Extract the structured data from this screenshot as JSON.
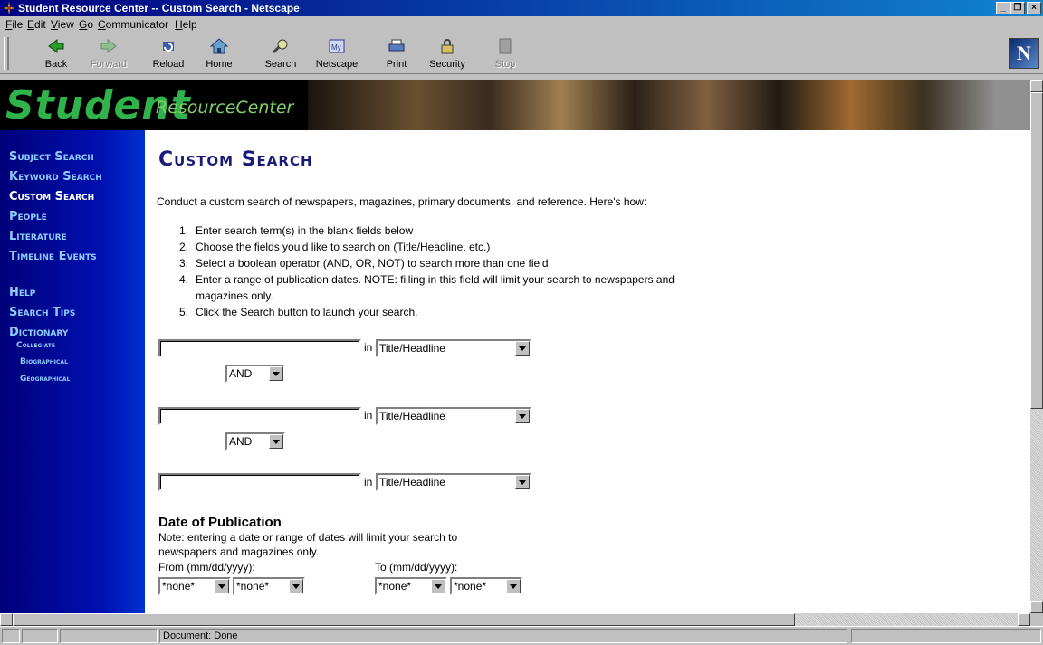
{
  "window": {
    "title": "Student Resource Center -- Custom Search - Netscape"
  },
  "menu": [
    "File",
    "Edit",
    "View",
    "Go",
    "Communicator",
    "Help"
  ],
  "toolbar": {
    "back": "Back",
    "forward": "Forward",
    "reload": "Reload",
    "home": "Home",
    "search": "Search",
    "netscape": "Netscape",
    "print": "Print",
    "security": "Security",
    "stop": "Stop"
  },
  "banner": {
    "word1": "Student",
    "word2": "ResourceCenter"
  },
  "sidebar": {
    "items": [
      {
        "label": "Subject Search"
      },
      {
        "label": "Keyword Search"
      },
      {
        "label": "Custom Search"
      },
      {
        "label": "People"
      },
      {
        "label": "Literature"
      },
      {
        "label": "Timeline Events"
      },
      {
        "label": "Help"
      },
      {
        "label": "Search Tips"
      },
      {
        "label": "Dictionary"
      }
    ],
    "dictionary_sub": [
      "Collegiate",
      "Biographical",
      "Geographical"
    ]
  },
  "main": {
    "heading": "Custom Search",
    "intro": "Conduct a custom search of newspapers, magazines, primary documents, and reference. Here's how:",
    "steps": [
      "Enter search term(s) in the blank fields below",
      "Choose the fields you'd like to search on (Title/Headline, etc.)",
      "Select a boolean operator (AND, OR, NOT) to search more than one field",
      "Enter a range of publication dates. NOTE: filling in this field will limit your search to newspapers and",
      "magazines only.",
      "Click the Search button to launch your search."
    ],
    "step_numbers": [
      "1.",
      "2.",
      "3.",
      "4.",
      "5."
    ],
    "in_label": "in",
    "field_select": "Title/Headline",
    "operator": "AND",
    "date": {
      "title": "Date of Publication",
      "note1": "Note: entering a date or range of dates will limit your search to",
      "note2": "newspapers and magazines only.",
      "from_label": "From (mm/dd/yyyy):",
      "to_label": "To (mm/dd/yyyy):",
      "none": "*none*"
    }
  },
  "status": {
    "text": "Document: Done"
  }
}
